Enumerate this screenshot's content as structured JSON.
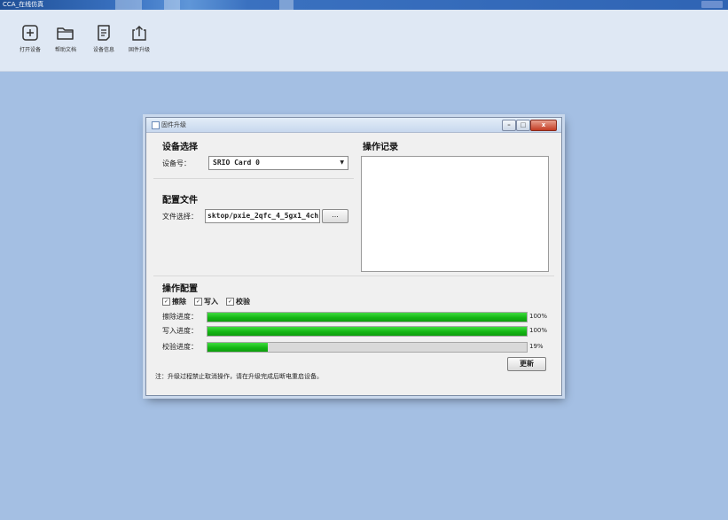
{
  "window": {
    "title": "CCA_在线仿真"
  },
  "toolbar": {
    "items": [
      {
        "label": "打开设备",
        "icon": "plus-square-icon"
      },
      {
        "label": "帮助文档",
        "icon": "folder-icon"
      },
      {
        "label": "设备信息",
        "icon": "document-icon"
      },
      {
        "label": "固件升级",
        "icon": "upload-icon"
      }
    ]
  },
  "dialog": {
    "title": "固件升级",
    "device_section": "设备选择",
    "device_label": "设备号：",
    "device_value": "SRIO Card 0",
    "config_section": "配置文件",
    "file_label": "文件选择：",
    "file_value": "sktop/pxie_2qfc_4_5gx1_4ch.",
    "browse_label": "...",
    "log_section": "操作记录",
    "op_section": "操作配置",
    "checks": [
      {
        "label": "擦除",
        "checked": true
      },
      {
        "label": "写入",
        "checked": true
      },
      {
        "label": "校验",
        "checked": true
      }
    ],
    "progress": [
      {
        "label": "擦除进度：",
        "value": 100,
        "text": "100%"
      },
      {
        "label": "写入进度：",
        "value": 100,
        "text": "100%"
      },
      {
        "label": "校验进度：",
        "value": 19,
        "text": "19%"
      }
    ],
    "update_label": "更新",
    "note": "注：升级过程禁止取消操作，请在升级完成后断电重启设备。"
  },
  "colors": {
    "workspace": "#a4bfe3",
    "progress_fill": "#14b614",
    "toolbar": "#dfe8f4"
  }
}
